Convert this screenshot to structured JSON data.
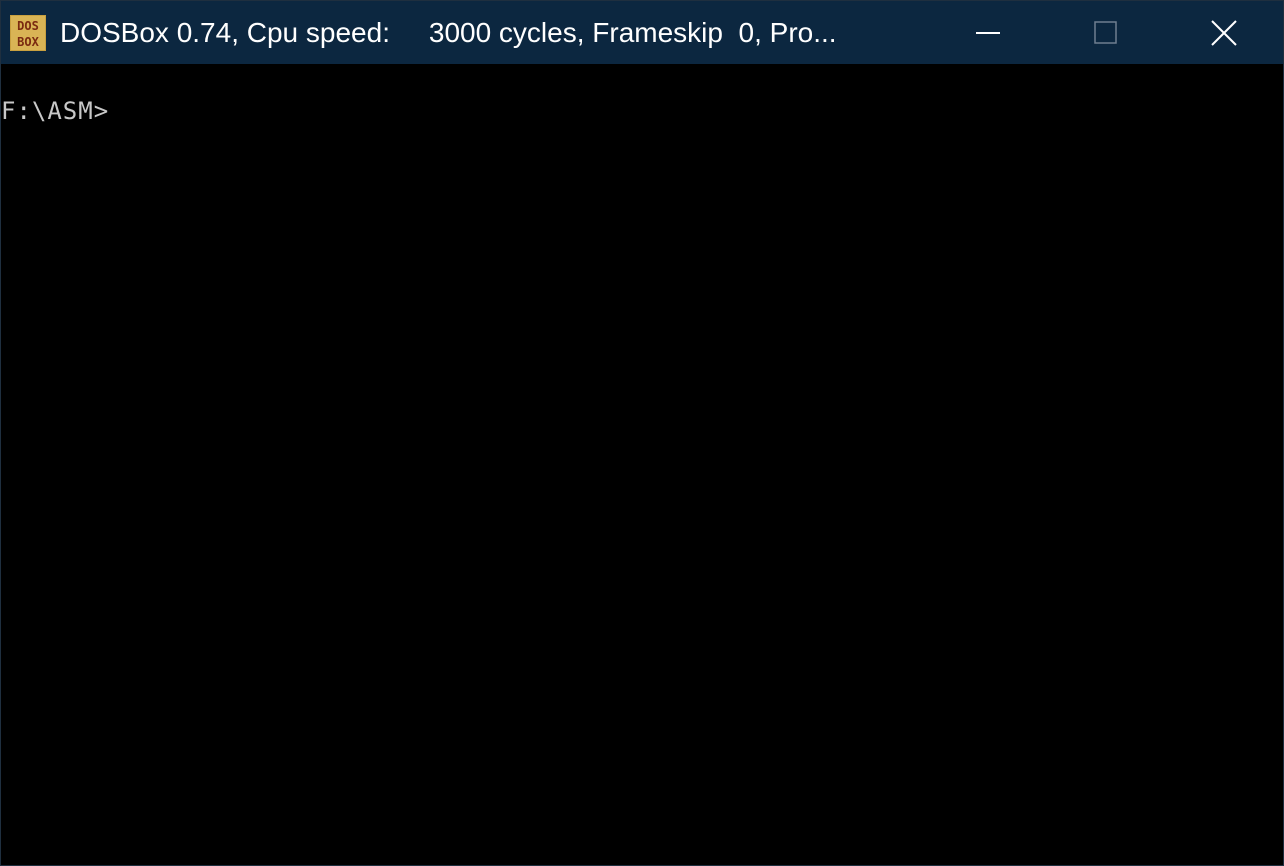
{
  "window": {
    "title": "DOSBox 0.74, Cpu speed:     3000 cycles, Frameskip  0, Pro...",
    "icon": "dosbox-icon",
    "icon_text_top": "DOS",
    "icon_text_bottom": "BOX",
    "controls": {
      "minimize": "minimize-icon",
      "maximize": "maximize-icon",
      "close": "close-icon"
    },
    "colors": {
      "titlebar": "#0c2740",
      "title_text": "#ffffff",
      "terminal_bg": "#000000",
      "terminal_text": "#c8c8c8",
      "icon_bg": "#c8a040",
      "icon_letters": "#7a2a10"
    }
  },
  "terminal": {
    "prompt": "F:\\ASM>"
  }
}
